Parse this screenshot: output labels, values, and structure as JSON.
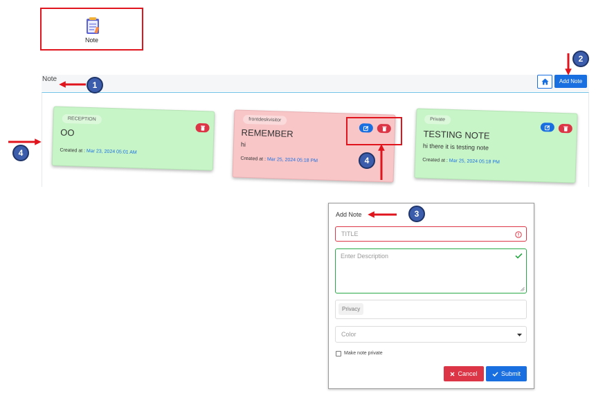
{
  "app_tile": {
    "label": "Note",
    "icon": "notepad-icon"
  },
  "header": {
    "title": "Note",
    "add_note_label": "Add Note",
    "home_icon": "home-icon"
  },
  "cards": [
    {
      "tag": "RECEPTION",
      "title": "OO",
      "description": "",
      "created_label": "Created at :",
      "created_date": "Mar 23, 2024 05:01 AM",
      "color": "#c8f5c8",
      "actions": [
        "delete"
      ]
    },
    {
      "tag": "frontdeskvisitor",
      "title": "REMEMBER",
      "description": "hi",
      "created_label": "Created at :",
      "created_date": "Mar 25, 2024 05:18 PM",
      "color": "#f9c6c8",
      "actions": [
        "edit",
        "delete"
      ]
    },
    {
      "tag": "Private",
      "title": "TESTING NOTE",
      "description": "hi there it is testing note",
      "created_label": "Created at :",
      "created_date": "Mar 25, 2024 05:18 PM",
      "color": "#c8f5c8",
      "actions": [
        "edit",
        "delete"
      ]
    }
  ],
  "modal": {
    "title": "Add Note",
    "title_placeholder": "TITLE",
    "description_placeholder": "Enter Description",
    "privacy_placeholder": "Privacy",
    "color_placeholder": "Color",
    "private_checkbox_label": "Make note private",
    "cancel_label": "Cancel",
    "submit_label": "Submit"
  },
  "annotations": {
    "c1": "1",
    "c2": "2",
    "c3": "3",
    "c4a": "4",
    "c4b": "4"
  },
  "colors": {
    "primary": "#1a6fe0",
    "danger": "#dc3545",
    "success": "#28a745",
    "annotation": "#e0141c"
  }
}
